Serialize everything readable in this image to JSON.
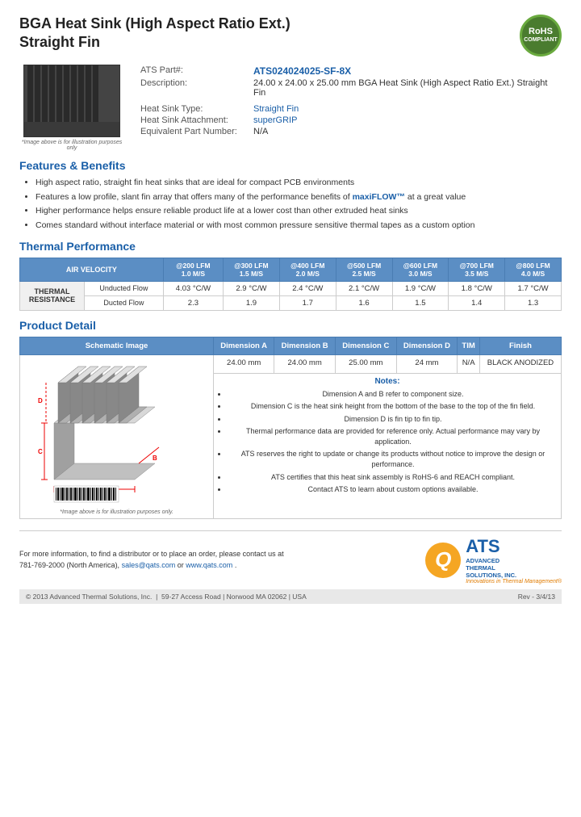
{
  "page": {
    "title_line1": "BGA Heat Sink (High Aspect Ratio Ext.)",
    "title_line2": "Straight Fin"
  },
  "product": {
    "part_label": "ATS Part#:",
    "part_number": "ATS024024025-SF-8X",
    "description_label": "Description:",
    "description": "24.00 x 24.00 x 25.00 mm  BGA Heat Sink (High Aspect Ratio Ext.) Straight Fin",
    "type_label": "Heat Sink Type:",
    "type_value": "Straight Fin",
    "attachment_label": "Heat Sink Attachment:",
    "attachment_value": "superGRIP",
    "equiv_label": "Equivalent Part Number:",
    "equiv_value": "N/A",
    "image_caption": "*Image above is for illustration purposes only"
  },
  "rohs": {
    "line1": "RoHS",
    "line2": "COMPLIANT"
  },
  "features": {
    "heading": "Features & Benefits",
    "items": [
      "High aspect ratio, straight fin heat sinks that are ideal for compact PCB environments",
      "Features a low profile, slant fin array that offers many of the performance benefits of maxiFLOW™ at a great value",
      "Higher performance helps ensure reliable product life at a lower cost than other extruded heat sinks",
      "Comes standard without interface material or with most common pressure sensitive thermal tapes as a custom option"
    ]
  },
  "thermal": {
    "heading": "Thermal Performance",
    "table": {
      "col_main": "AIR VELOCITY",
      "columns": [
        {
          "label": "@200 LFM",
          "sub": "1.0 M/S"
        },
        {
          "label": "@300 LFM",
          "sub": "1.5 M/S"
        },
        {
          "label": "@400 LFM",
          "sub": "2.0 M/S"
        },
        {
          "label": "@500 LFM",
          "sub": "2.5 M/S"
        },
        {
          "label": "@600 LFM",
          "sub": "3.0 M/S"
        },
        {
          "label": "@700 LFM",
          "sub": "3.5 M/S"
        },
        {
          "label": "@800 LFM",
          "sub": "4.0 M/S"
        }
      ],
      "row_label": "THERMAL RESISTANCE",
      "rows": [
        {
          "sub_label": "Unducted Flow",
          "values": [
            "4.03 °C/W",
            "2.9 °C/W",
            "2.4 °C/W",
            "2.1 °C/W",
            "1.9 °C/W",
            "1.8 °C/W",
            "1.7 °C/W"
          ]
        },
        {
          "sub_label": "Ducted Flow",
          "values": [
            "2.3",
            "1.9",
            "1.7",
            "1.6",
            "1.5",
            "1.4",
            "1.3"
          ]
        }
      ]
    }
  },
  "product_detail": {
    "heading": "Product Detail",
    "columns": [
      "Schematic Image",
      "Dimension A",
      "Dimension B",
      "Dimension C",
      "Dimension D",
      "TIM",
      "Finish"
    ],
    "values": [
      "24.00 mm",
      "24.00 mm",
      "25.00 mm",
      "24 mm",
      "N/A",
      "BLACK ANODIZED"
    ],
    "image_caption": "*Image above is for illustration purposes only.",
    "notes": {
      "heading": "Notes:",
      "items": [
        "Dimension A and B refer to component size.",
        "Dimension C is the heat sink height from the bottom of the base to the top of the fin field.",
        "Dimension D is fin tip to fin tip.",
        "Thermal performance data are provided for reference only. Actual performance may vary by application.",
        "ATS reserves the right to update or change its products without notice to improve the design or performance.",
        "ATS certifies that this heat sink assembly is RoHS-6 and REACH compliant.",
        "Contact ATS to learn about custom options available."
      ]
    }
  },
  "footer": {
    "contact_text": "For more information, to find a distributor or to place an order, please contact us at",
    "phone": "781-769-2000 (North America),",
    "email": "sales@qats.com",
    "email_or": " or ",
    "website": "www.qats.com",
    "website_end": ".",
    "copyright": "© 2013 Advanced Thermal Solutions, Inc.",
    "address": "59-27 Access Road  |  Norwood MA  02062  |  USA",
    "revision": "Rev - 3/4/13"
  },
  "ats_logo": {
    "q_letter": "Q",
    "ats": "ATS",
    "line1": "ADVANCED",
    "line2": "THERMAL",
    "line3": "SOLUTIONS, INC.",
    "tagline": "Innovations in Thermal Management®"
  }
}
